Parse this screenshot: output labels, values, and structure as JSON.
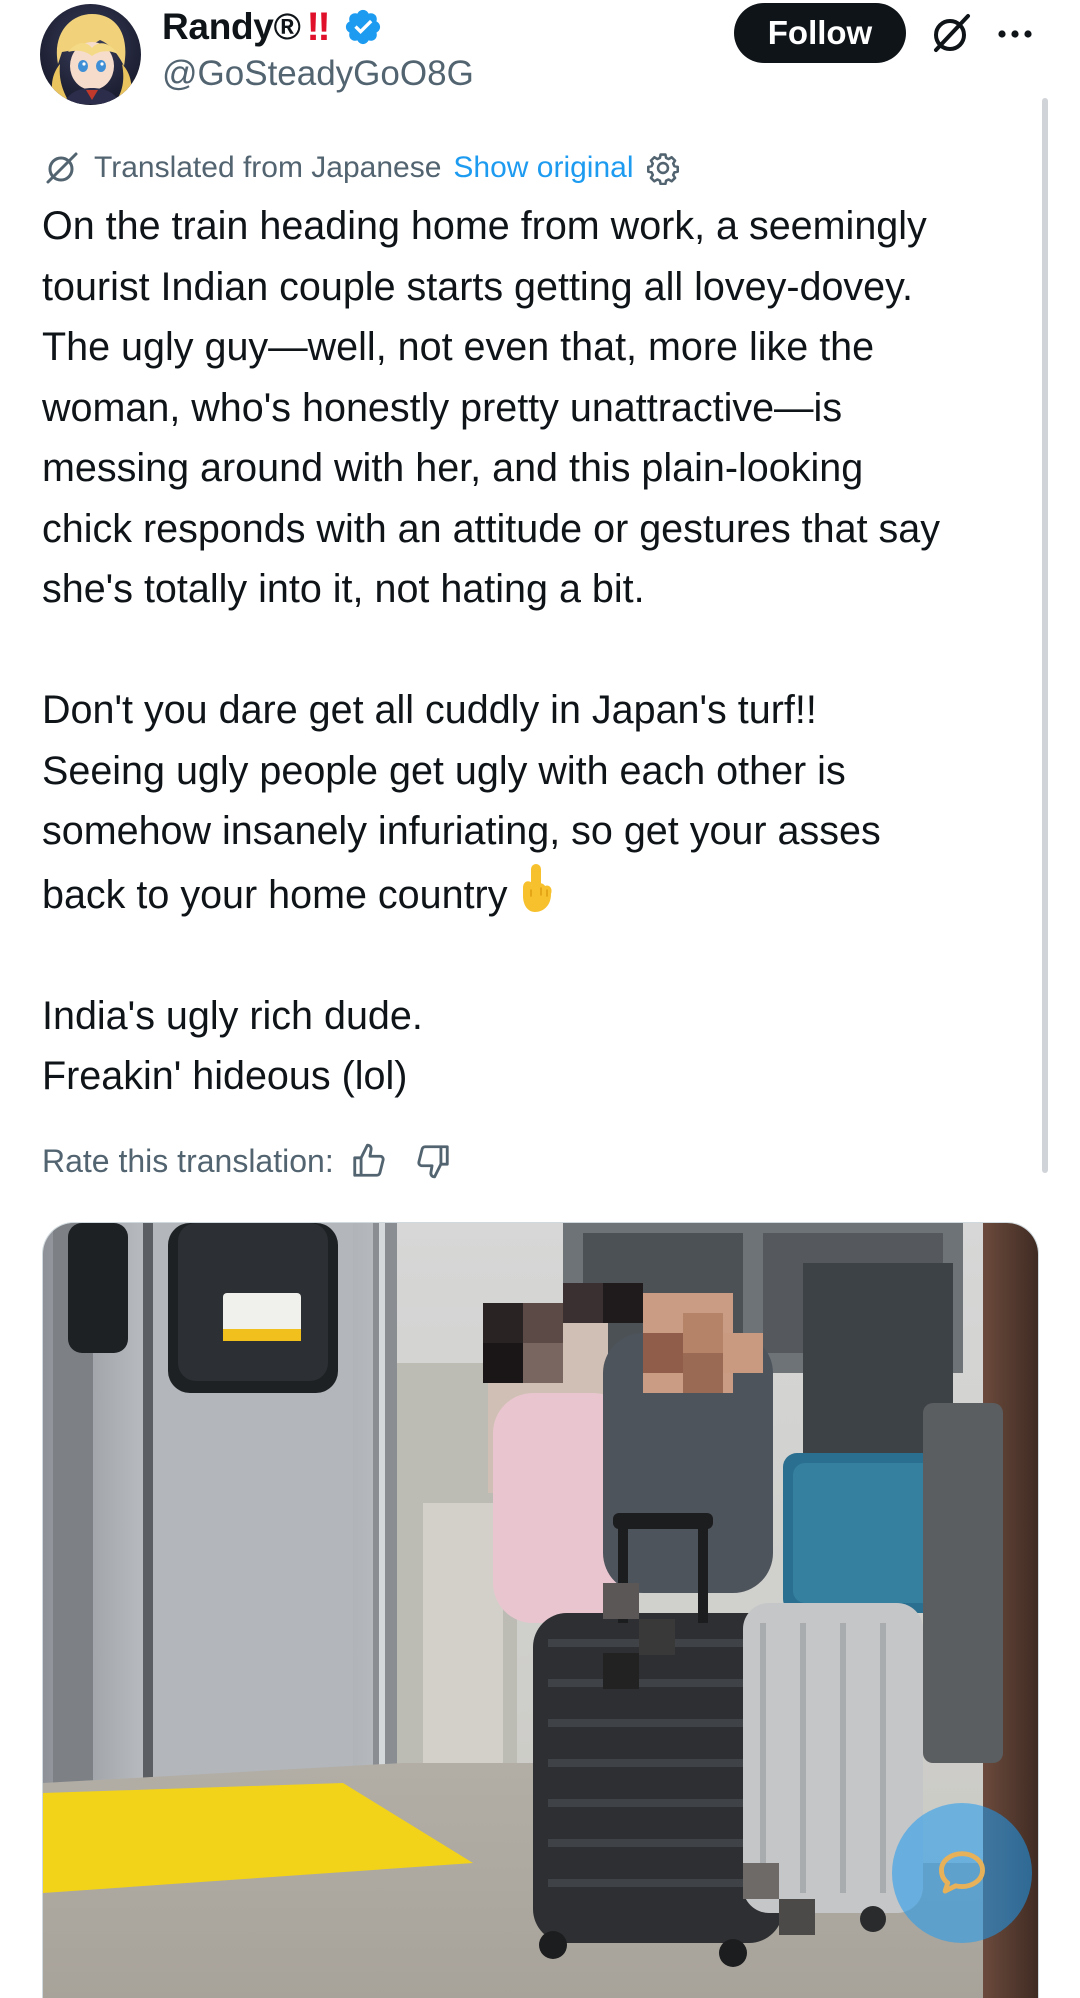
{
  "author": {
    "display_name": "Randy®",
    "display_suffix": "‼",
    "handle": "@GoSteadyGoO8G",
    "verified": true,
    "verified_color": "#1d9bf0"
  },
  "header": {
    "follow_label": "Follow",
    "grok_icon": "grok-icon",
    "more_icon": "more-icon"
  },
  "translation": {
    "translated_from": "Translated from Japanese",
    "show_original": "Show original",
    "settings_icon": "gear-icon",
    "rate_label": "Rate this translation:"
  },
  "tweet": {
    "paragraphs": [
      {
        "lines": [
          "On the train heading home from work, a seemingly",
          "tourist Indian couple starts getting all lovey-dovey.",
          "The ugly guy—well, not even that, more like the",
          "woman, who's honestly pretty unattractive—is",
          "messing around with her, and this plain-looking",
          "chick responds with an attitude or gestures that say",
          "she's totally into it, not hating a bit."
        ]
      },
      {
        "lines": [
          "Don't you dare get all cuddly in Japan's turf!!",
          "Seeing ugly people get ugly with each other is",
          "somehow insanely infuriating, so get your asses",
          "back to your home country"
        ]
      },
      {
        "lines": [
          "India's ugly rich dude.",
          "Freakin' hideous (lol)"
        ]
      }
    ]
  },
  "colors": {
    "text_primary": "#0f1419",
    "text_secondary": "#536471",
    "link": "#1d9bf0",
    "follow_bg": "#0f1419"
  }
}
